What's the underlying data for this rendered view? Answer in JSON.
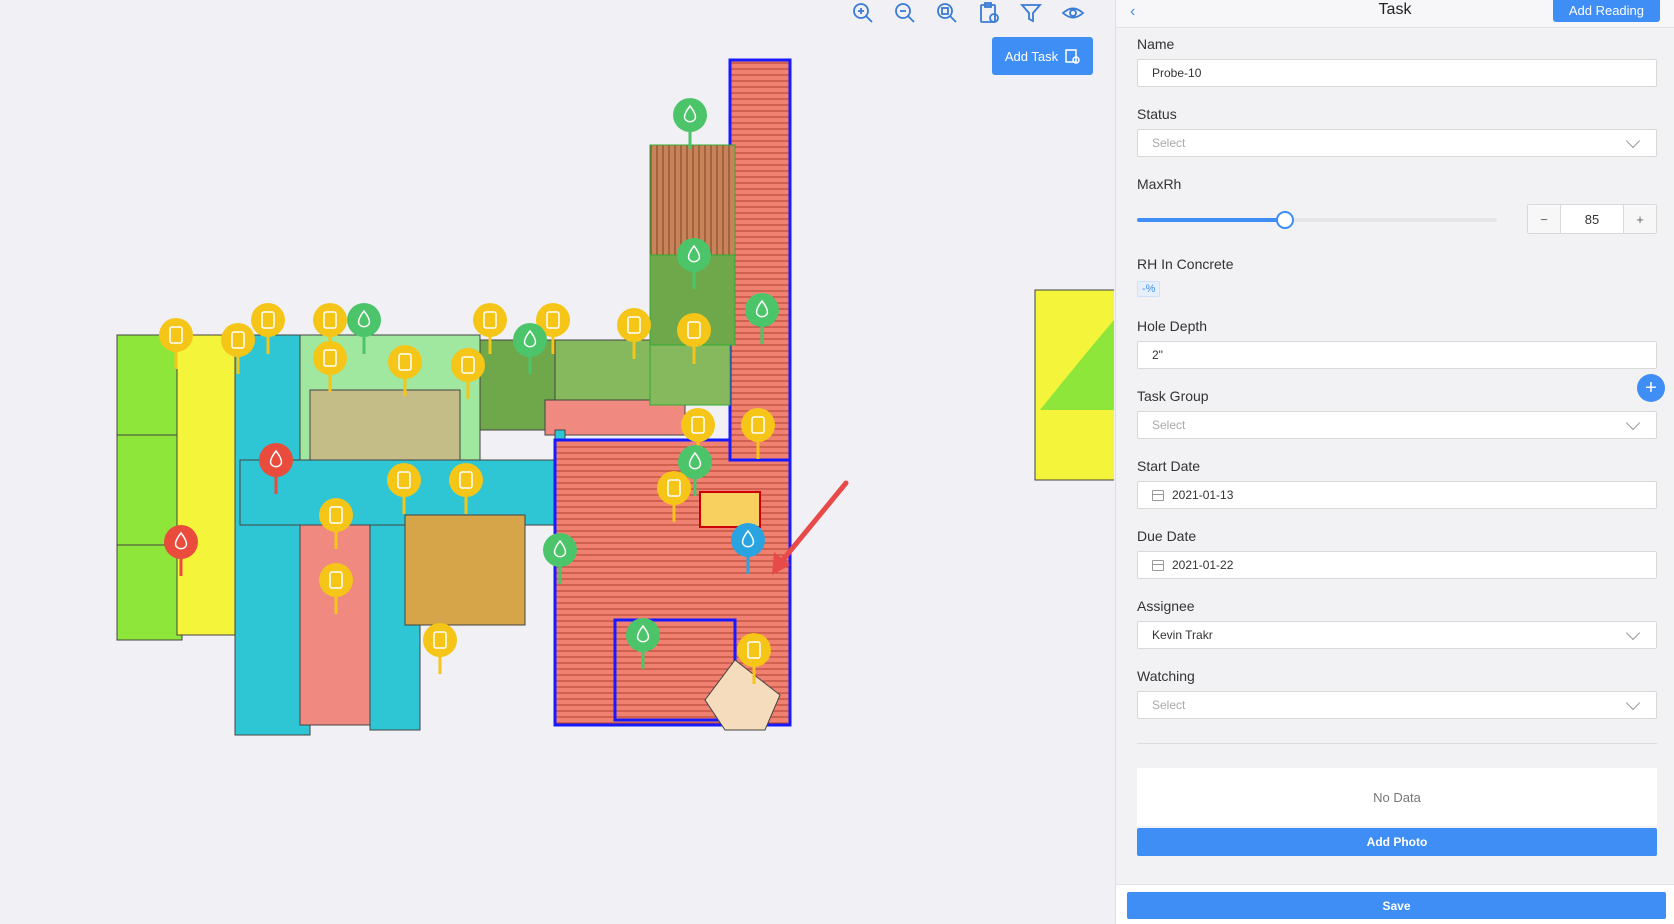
{
  "toolbar": {
    "icons": [
      "zoom-in-icon",
      "zoom-out-icon",
      "zoom-fit-icon",
      "clipboard-add-icon",
      "filter-icon",
      "eye-icon"
    ]
  },
  "add_task": {
    "label": "Add Task"
  },
  "panel": {
    "title": "Task",
    "add_reading": "Add Reading",
    "name": {
      "label": "Name",
      "value": "Probe-10"
    },
    "status": {
      "label": "Status",
      "placeholder": "Select"
    },
    "maxrh": {
      "label": "MaxRh",
      "value": "85",
      "slider_fraction": 0.41
    },
    "rh_concrete": {
      "label": "RH In Concrete",
      "value": "-%"
    },
    "hole_depth": {
      "label": "Hole Depth",
      "value": "2\""
    },
    "task_group": {
      "label": "Task Group",
      "placeholder": "Select"
    },
    "start_date": {
      "label": "Start Date",
      "value": "2021-01-13"
    },
    "due_date": {
      "label": "Due Date",
      "value": "2021-01-22"
    },
    "assignee": {
      "label": "Assignee",
      "value": "Kevin Trakr"
    },
    "watching": {
      "label": "Watching",
      "placeholder": "Select"
    },
    "photos_empty": "No Data",
    "add_photo": "Add Photo",
    "save": "Save"
  },
  "colors": {
    "accent": "#3f8ef5",
    "pin_yellow": "#f5c518",
    "pin_green": "#4cc56a",
    "pin_red": "#e94b3c",
    "pin_blue": "#29a4e0"
  }
}
